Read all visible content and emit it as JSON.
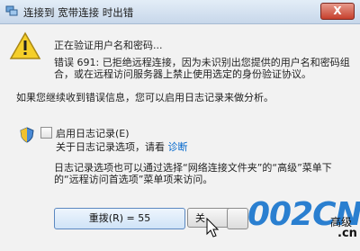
{
  "titlebar": {
    "title": "连接到 宽带连接 时出错",
    "close_label": "X"
  },
  "message": {
    "verify_text": "正在验证用户名和密码...",
    "error_text": "错误 691: 已拒绝远程连接，因为未识别出您提供的用户名和密码组合，或在远程访问服务器上禁止使用选定的身份验证协议。",
    "hint_text": "如果您继续收到错误信息，您可以启用日志记录来做分析。"
  },
  "logging": {
    "checkbox_label": "启用日志记录(E)",
    "checked": false,
    "about_text": "关于日志记录选项，请看",
    "diagnose_link": "诊断"
  },
  "description": "日志记录选项也可以通过选择“网络连接文件夹”的“高级”菜单下的“远程访问首选项”菜单项来访问。",
  "buttons": {
    "redial": "重拨(R) = 55",
    "close": "关"
  },
  "watermark": {
    "logo": "002CN",
    "suffix": "高级",
    "tld": ".cn"
  },
  "icons": [
    "warning-icon",
    "shield-icon",
    "network-icon",
    "cursor-icon"
  ],
  "colors": {
    "accent": "#2a7fd0",
    "warning": "#f0c419",
    "link": "#0066cc"
  }
}
